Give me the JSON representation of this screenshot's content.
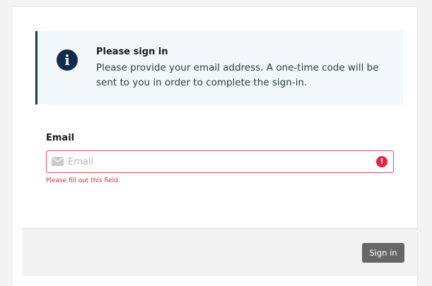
{
  "notice": {
    "icon": "info-icon",
    "icon_glyph": "i",
    "title": "Please sign in",
    "message": "Please provide your email address. A one-time code will be sent to you in order to complete the sign-in."
  },
  "form": {
    "email_label": "Email",
    "email_placeholder": "Email",
    "email_value": "",
    "email_icon": "mail-icon",
    "error_icon": "error-icon",
    "error_glyph": "!",
    "error_message": "Please fill out this field."
  },
  "footer": {
    "sign_in_label": "Sign in"
  },
  "colors": {
    "info_icon_bg": "#0f2d4a",
    "notice_bg": "#f2f8f9",
    "error": "#e0263f",
    "button_bg": "#666666"
  }
}
